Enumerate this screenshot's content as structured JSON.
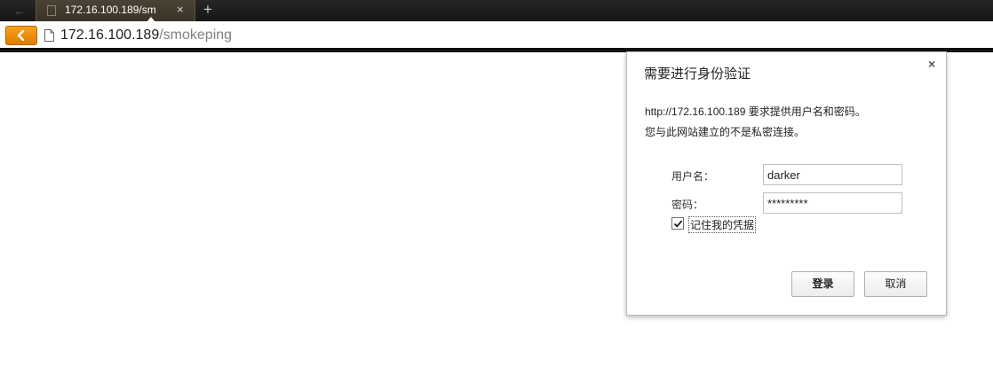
{
  "browser": {
    "tab": {
      "title": "172.16.100.189/sm",
      "close_symbol": "×",
      "new_tab_symbol": "+"
    },
    "back_icon_ghost": "←",
    "address": {
      "host": "172.16.100.189",
      "path": "/smokeping"
    },
    "accent_color": "#f08c00"
  },
  "dialog": {
    "title": "需要进行身份验证",
    "close_symbol": "×",
    "message_line1": "http://172.16.100.189 要求提供用户名和密码。",
    "message_line2": "您与此网站建立的不是私密连接。",
    "username_label": "用户名：",
    "username_value": "darker",
    "password_label": "密码：",
    "password_value": "*********",
    "remember": {
      "label": "记住我的凭据",
      "checked": true
    },
    "login_button": "登录",
    "cancel_button": "取消"
  }
}
